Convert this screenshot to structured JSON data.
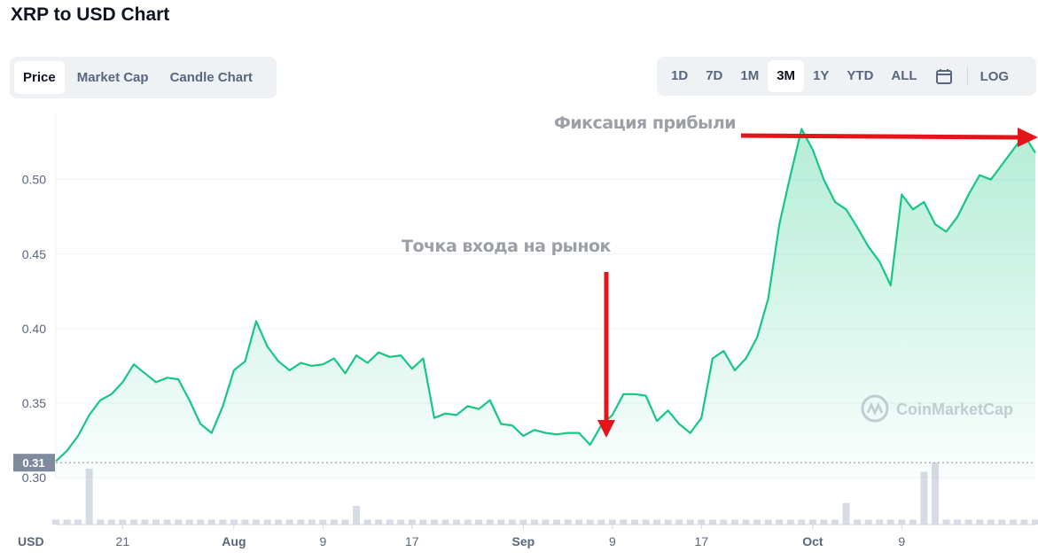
{
  "title": "XRP to USD Chart",
  "tabs": [
    "Price",
    "Market Cap",
    "Candle Chart"
  ],
  "active_tab": "Price",
  "ranges": [
    "1D",
    "7D",
    "1M",
    "3M",
    "1Y",
    "YTD",
    "ALL"
  ],
  "active_range": "3M",
  "log_label": "LOG",
  "currency_label": "USD",
  "current_price_tag": "0.31",
  "watermark": "CoinMarketCap",
  "annotations": {
    "entry": "Точка входа на рынок",
    "exit": "Фиксация прибыли"
  },
  "colors": {
    "line": "#16c784",
    "arrow": "#e3151a",
    "volume": "#a6b0c3"
  },
  "chart_data": {
    "type": "area",
    "title": "XRP to USD Chart",
    "ylabel": "USD",
    "ylim": [
      0.3,
      0.545
    ],
    "y_ticks": [
      "0.30",
      "0.35",
      "0.40",
      "0.45",
      "0.50"
    ],
    "x_ticks": [
      "21",
      "Aug",
      "9",
      "17",
      "Sep",
      "9",
      "17",
      "Oct",
      "9"
    ],
    "x_index_range": [
      0,
      88
    ],
    "x_tick_index": [
      6,
      16,
      24,
      32,
      42,
      50,
      58,
      68,
      76
    ],
    "series": [
      {
        "values": [
          0.311,
          0.318,
          0.328,
          0.342,
          0.352,
          0.356,
          0.364,
          0.376,
          0.37,
          0.364,
          0.367,
          0.366,
          0.352,
          0.336,
          0.33,
          0.348,
          0.372,
          0.378,
          0.405,
          0.388,
          0.378,
          0.372,
          0.377,
          0.375,
          0.376,
          0.38,
          0.37,
          0.382,
          0.377,
          0.384,
          0.381,
          0.382,
          0.373,
          0.38,
          0.34,
          0.343,
          0.342,
          0.348,
          0.346,
          0.352,
          0.336,
          0.335,
          0.328,
          0.332,
          0.33,
          0.329,
          0.33,
          0.33,
          0.322,
          0.335,
          0.342,
          0.356,
          0.356,
          0.355,
          0.338,
          0.345,
          0.336,
          0.33,
          0.34,
          0.38,
          0.385,
          0.372,
          0.38,
          0.394,
          0.42,
          0.47,
          0.503,
          0.534,
          0.52,
          0.5,
          0.485,
          0.48,
          0.468,
          0.455,
          0.445,
          0.429,
          0.49,
          0.48,
          0.485,
          0.47,
          0.465,
          0.475,
          0.49,
          0.503,
          0.5,
          0.51,
          0.52,
          0.53,
          0.518
        ]
      }
    ],
    "volume_spikes": [
      {
        "index": 3,
        "value": 0.9
      },
      {
        "index": 27,
        "value": 0.3
      },
      {
        "index": 71,
        "value": 0.35
      },
      {
        "index": 78,
        "value": 0.85
      },
      {
        "index": 79,
        "value": 1.0
      }
    ]
  }
}
